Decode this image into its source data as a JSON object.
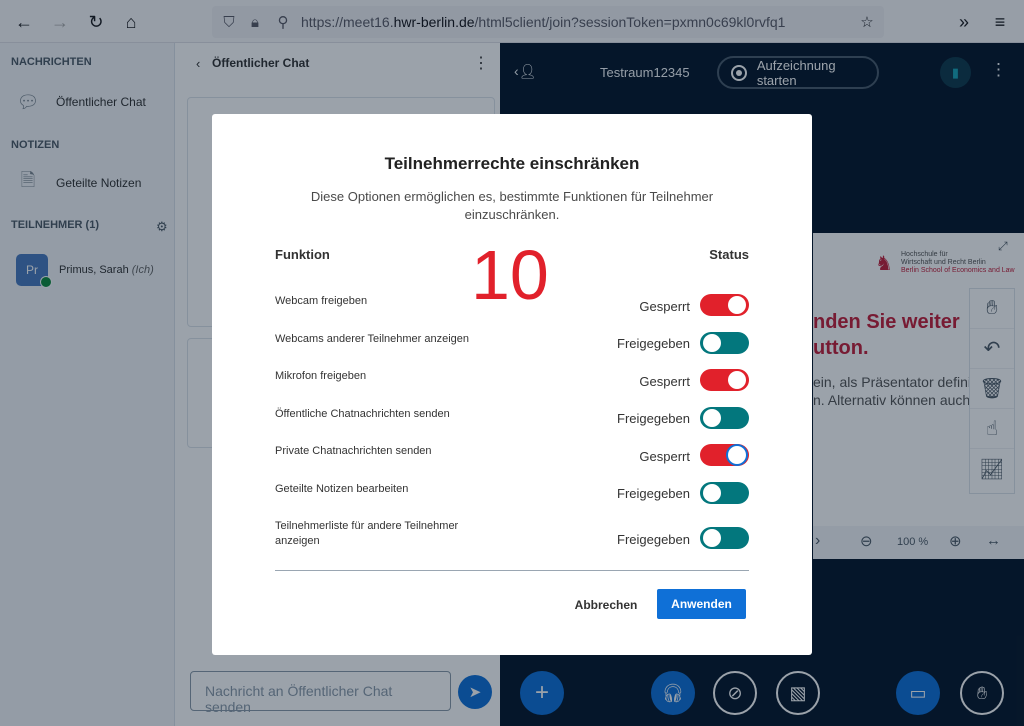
{
  "browser": {
    "url_prefix": "https://meet16.",
    "url_domain": "hwr-berlin.de",
    "url_path": "/html5client/join?sessionToken=pxmn0c69kl0rvfq1"
  },
  "userlist": {
    "messages_title": "NACHRICHTEN",
    "public_chat": "Öffentlicher Chat",
    "notes_title": "NOTIZEN",
    "shared_notes": "Geteilte Notizen",
    "participants_title": "TEILNEHMER (1)",
    "user_initials": "Pr",
    "user_name": "Primus, Sarah",
    "user_me": "(Ich)"
  },
  "chat": {
    "header": "Öffentlicher Chat",
    "input_placeholder": "Nachricht an Öffentlicher Chat senden"
  },
  "main": {
    "room_name": "Testraum12345",
    "record_label": "Aufzeichnung starten",
    "pres_logo_line1": "Hochschule für",
    "pres_logo_line2": "Wirtschaft und Recht Berlin",
    "pres_logo_line3": "Berlin School of Economics and Law",
    "pres_text_1": "nden Sie weiter",
    "pres_text_2": "utton.",
    "pres_text_3": "ein, als Präsentator defini",
    "pres_text_4": "n. Alternativ können auch",
    "zoom": "100 %"
  },
  "modal": {
    "title": "Teilnehmerrechte einschränken",
    "description": "Diese Optionen ermöglichen es, bestimmte Funktionen für Teilnehmer einzuschränken.",
    "col_function": "Funktion",
    "col_status": "Status",
    "big_number": "10",
    "rows": [
      {
        "label": "Webcam freigeben",
        "status": "Gesperrt",
        "locked": true
      },
      {
        "label": "Webcams anderer Teilnehmer anzeigen",
        "status": "Freigegeben",
        "locked": false
      },
      {
        "label": "Mikrofon freigeben",
        "status": "Gesperrt",
        "locked": true
      },
      {
        "label": "Öffentliche Chatnachrichten senden",
        "status": "Freigegeben",
        "locked": false
      },
      {
        "label": "Private Chatnachrichten senden",
        "status": "Gesperrt",
        "locked": true
      },
      {
        "label": "Geteilte Notizen bearbeiten",
        "status": "Freigegeben",
        "locked": false
      },
      {
        "label": "Teilnehmerliste für andere Teilnehmer anzeigen",
        "status": "Freigegeben",
        "locked": false
      }
    ],
    "cancel_label": "Abbrechen",
    "apply_label": "Anwenden"
  },
  "colors": {
    "locked": "#e1212b",
    "unlocked": "#03777d",
    "primary": "#0f70d7"
  }
}
